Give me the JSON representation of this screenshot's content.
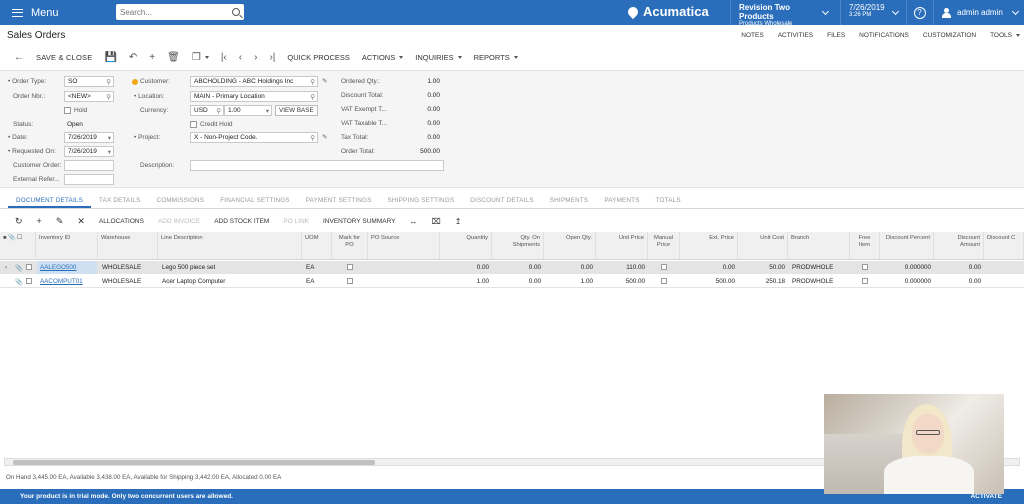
{
  "topbar": {
    "menu_label": "Menu",
    "search_placeholder": "Search...",
    "logo_text": "Acumatica",
    "tenant_title": "Revision Two Products",
    "tenant_sub": "Products Wholesale",
    "date": "7/26/2019",
    "time": "3:26 PM",
    "help_glyph": "?",
    "user_name": "admin admin"
  },
  "page": {
    "title": "Sales Orders",
    "links": [
      "NOTES",
      "ACTIVITIES",
      "FILES",
      "NOTIFICATIONS",
      "CUSTOMIZATION",
      "TOOLS"
    ]
  },
  "toolbar": {
    "save_close": "SAVE & CLOSE",
    "quick_process": "QUICK PROCESS",
    "actions": "ACTIONS",
    "inquiries": "INQUIRIES",
    "reports": "REPORTS"
  },
  "form": {
    "order_type_label": "Order Type:",
    "order_type": "SO",
    "order_nbr_label": "Order Nbr.:",
    "order_nbr": "<NEW>",
    "hold_label": "Hold",
    "status_label": "Status:",
    "status": "Open",
    "date_label": "Date:",
    "date": "7/26/2019",
    "requested_on_label": "Requested On:",
    "requested_on": "7/26/2019",
    "customer_order_label": "Customer Order:",
    "external_ref_label": "External Refer...",
    "customer_label": "Customer:",
    "customer": "ABCHOLDING - ABC Holdings Inc",
    "location_label": "Location:",
    "location": "MAIN - Primary Location",
    "currency_label": "Currency:",
    "currency": "USD",
    "rate": "1.00",
    "view_base": "VIEW BASE",
    "credit_hold_label": "Credit Hold",
    "project_label": "Project:",
    "project": "X - Non-Project Code.",
    "description_label": "Description:",
    "totals": [
      {
        "label": "Ordered Qty.:",
        "value": "1.00"
      },
      {
        "label": "Discount Total:",
        "value": "0.00"
      },
      {
        "label": "VAT Exempt T...",
        "value": "0.00"
      },
      {
        "label": "VAT Taxable T...",
        "value": "0.00"
      },
      {
        "label": "Tax Total:",
        "value": "0.00"
      },
      {
        "label": "Order Total:",
        "value": "500.00"
      }
    ]
  },
  "tabs": [
    "DOCUMENT DETAILS",
    "TAX DETAILS",
    "COMMISSIONS",
    "FINANCIAL SETTINGS",
    "PAYMENT SETTINGS",
    "SHIPPING SETTINGS",
    "DISCOUNT DETAILS",
    "SHIPMENTS",
    "PAYMENTS",
    "TOTALS"
  ],
  "grid_toolbar": {
    "allocations": "ALLOCATIONS",
    "add_invoice": "ADD INVOICE",
    "add_stock_item": "ADD STOCK ITEM",
    "po_link": "PO LINK",
    "inventory_summary": "INVENTORY SUMMARY"
  },
  "grid": {
    "headers": {
      "inventory_id": "Inventory ID",
      "warehouse": "Warehouse",
      "line_description": "Line Description",
      "uom": "UOM",
      "mark_for_po": "Mark for PO",
      "po_source": "PO Source",
      "quantity": "Quantity",
      "qty_on_shipments": "Qty. On Shipments",
      "open_qty": "Open Qty.",
      "unit_price": "Unit Price",
      "manual_price": "Manual Price",
      "ext_price": "Ext. Price",
      "unit_cost": "Unit Cost",
      "branch": "Branch",
      "free_item": "Free Item",
      "discount_percent": "Discount Percent",
      "discount_amount": "Discount Amount",
      "discount_code": "Discount C"
    },
    "rows": [
      {
        "inventory_id": "AALEGO500",
        "warehouse": "WHOLESALE",
        "line_description": "Lego 500 piece set",
        "uom": "EA",
        "quantity": "0.00",
        "qty_on_shipments": "0.00",
        "open_qty": "0.00",
        "unit_price": "110.00",
        "ext_price": "0.00",
        "unit_cost": "50.00",
        "branch": "PRODWHOLE",
        "discount_percent": "0.000000",
        "discount_amount": "0.00"
      },
      {
        "inventory_id": "AACOMPUT01",
        "warehouse": "WHOLESALE",
        "line_description": "Acer Laptop Computer",
        "uom": "EA",
        "quantity": "1.00",
        "qty_on_shipments": "0.00",
        "open_qty": "1.00",
        "unit_price": "500.00",
        "ext_price": "500.00",
        "unit_cost": "250.18",
        "branch": "PRODWHOLE",
        "discount_percent": "0.000000",
        "discount_amount": "0.00"
      }
    ]
  },
  "info_bar": "On Hand 3,445.00 EA, Available 3,438.00 EA, Available for Shipping 3,442.00 EA, Allocated 0.00 EA",
  "trial_bar": {
    "message": "Your product is in trial mode. Only two concurrent users are allowed.",
    "activate": "ACTIVATE"
  }
}
